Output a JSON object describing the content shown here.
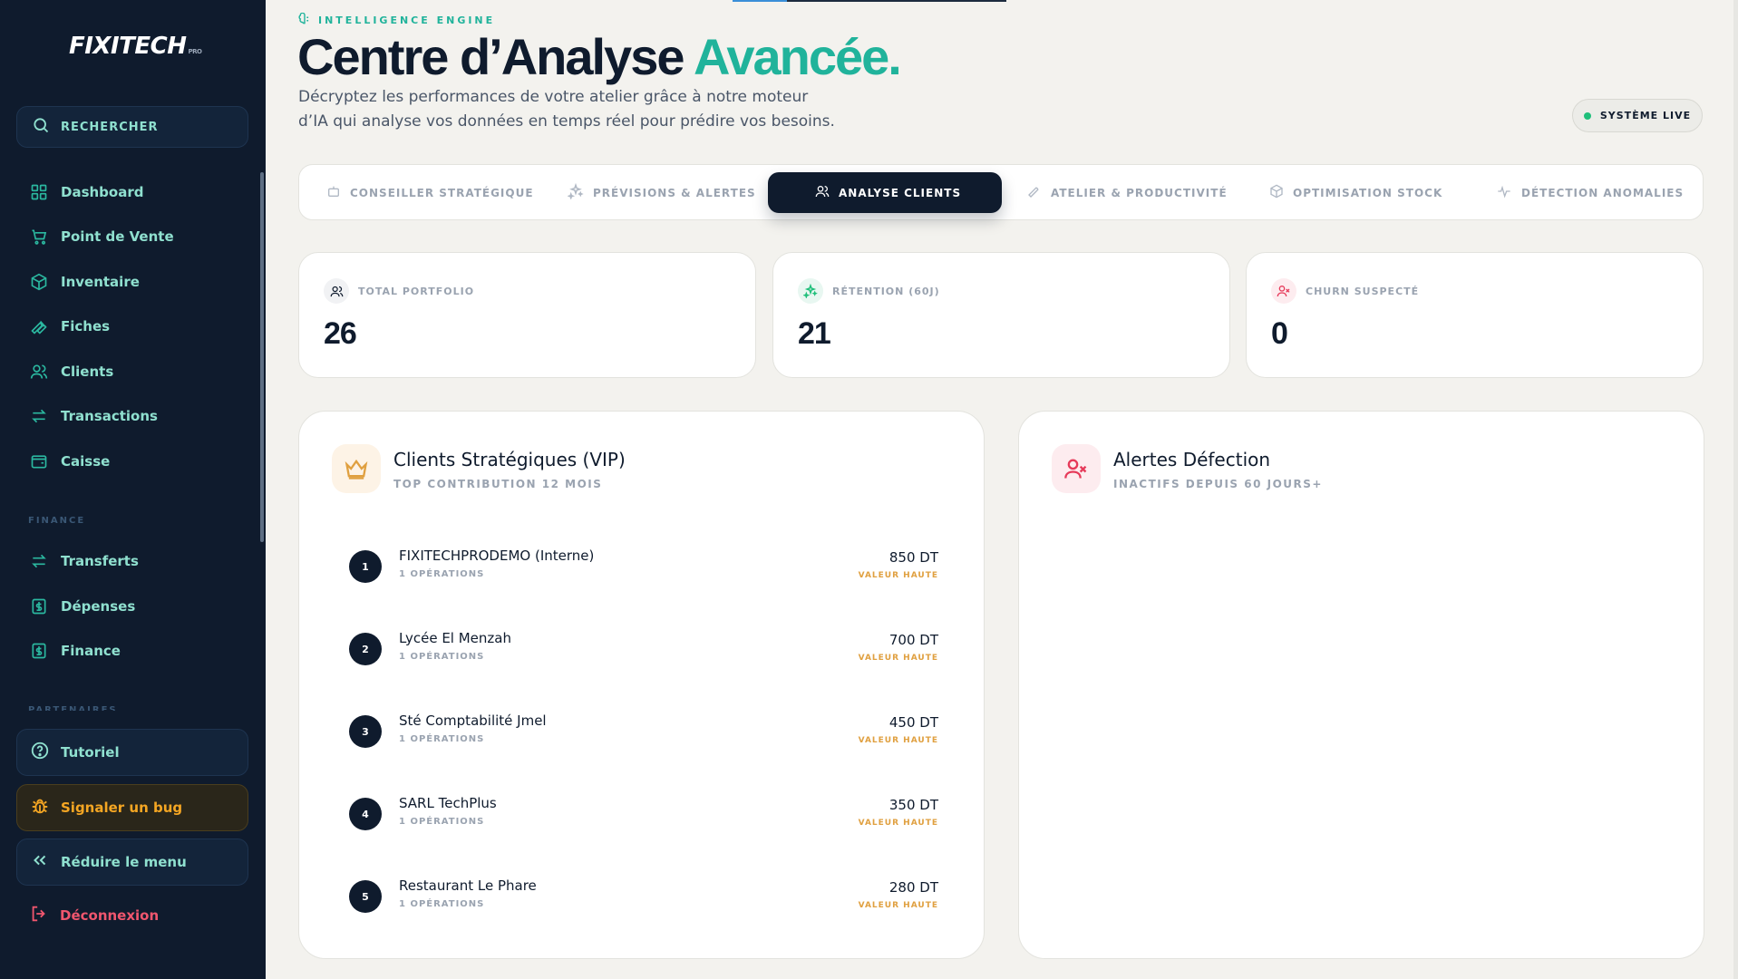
{
  "sidebar": {
    "logo": {
      "main": "FIXITECH",
      "suffix": "PRO"
    },
    "search_label": "RECHERCHER",
    "items": [
      {
        "label": "Dashboard",
        "icon": "grid-icon"
      },
      {
        "label": "Point de Vente",
        "icon": "cart-icon"
      },
      {
        "label": "Inventaire",
        "icon": "box-icon"
      },
      {
        "label": "Fiches",
        "icon": "wrench-icon"
      },
      {
        "label": "Clients",
        "icon": "users-icon"
      },
      {
        "label": "Transactions",
        "icon": "arrows-icon"
      },
      {
        "label": "Caisse",
        "icon": "wallet-icon"
      }
    ],
    "finance_section": "FINANCE",
    "finance_items": [
      {
        "label": "Transferts",
        "icon": "arrows-icon"
      },
      {
        "label": "Dépenses",
        "icon": "dollar-icon"
      },
      {
        "label": "Finance",
        "icon": "dollar-icon"
      }
    ],
    "partners_section": "PARTENAIRES",
    "tutorial_label": "Tutoriel",
    "bug_label": "Signaler un bug",
    "reduce_label": "Réduire le menu",
    "logout_label": "Déconnexion"
  },
  "header": {
    "eyebrow": "INTELLIGENCE ENGINE",
    "title_main": "Centre d’Analyse ",
    "title_accent": "Avancée.",
    "subtitle_line1": "Décryptez les performances de votre atelier grâce à notre moteur",
    "subtitle_line2": "d’IA qui analyse vos données en temps réel pour prédire vos besoins.",
    "live_badge": "SYSTÈME LIVE"
  },
  "tabs": [
    {
      "label": "CONSEILLER STRATÉGIQUE",
      "icon": "robot-icon"
    },
    {
      "label": "PRÉVISIONS & ALERTES",
      "icon": "sparkles-icon"
    },
    {
      "label": "ANALYSE CLIENTS",
      "icon": "users-icon",
      "active": true
    },
    {
      "label": "ATELIER & PRODUCTIVITÉ",
      "icon": "wrench-icon"
    },
    {
      "label": "OPTIMISATION STOCK",
      "icon": "box-icon"
    },
    {
      "label": "DÉTECTION ANOMALIES",
      "icon": "pulse-icon"
    }
  ],
  "stats": [
    {
      "label": "TOTAL PORTFOLIO",
      "value": "26",
      "icon": "users-icon"
    },
    {
      "label": "RÉTENTION (60J)",
      "value": "21",
      "icon": "sparkles-icon"
    },
    {
      "label": "CHURN SUSPECTÉ",
      "value": "0",
      "icon": "user-x-icon"
    }
  ],
  "vip_panel": {
    "title": "Clients Stratégiques (VIP)",
    "subtitle": "TOP CONTRIBUTION 12 MOIS",
    "icon": "crown-icon",
    "rows": [
      {
        "rank": "1",
        "name": "FIXITECHPRODEMO (Interne)",
        "ops": "1 OPÉRATIONS",
        "amount": "850 DT",
        "tier": "VALEUR HAUTE"
      },
      {
        "rank": "2",
        "name": "Lycée El Menzah",
        "ops": "1 OPÉRATIONS",
        "amount": "700 DT",
        "tier": "VALEUR HAUTE"
      },
      {
        "rank": "3",
        "name": "Sté Comptabilité Jmel",
        "ops": "1 OPÉRATIONS",
        "amount": "450 DT",
        "tier": "VALEUR HAUTE"
      },
      {
        "rank": "4",
        "name": "SARL TechPlus",
        "ops": "1 OPÉRATIONS",
        "amount": "350 DT",
        "tier": "VALEUR HAUTE"
      },
      {
        "rank": "5",
        "name": "Restaurant Le Phare",
        "ops": "1 OPÉRATIONS",
        "amount": "280 DT",
        "tier": "VALEUR HAUTE"
      }
    ]
  },
  "churn_panel": {
    "title": "Alertes Défection",
    "subtitle": "INACTIFS DEPUIS 60 JOURS+",
    "icon": "user-x-icon"
  },
  "colors": {
    "sidebar_bg": "#0f1b2d",
    "accent_teal": "#20b39b",
    "sidebar_text": "#8fe0cf",
    "warning": "#f5a623",
    "danger": "#f0566e",
    "vip_gold": "#e0a040"
  }
}
